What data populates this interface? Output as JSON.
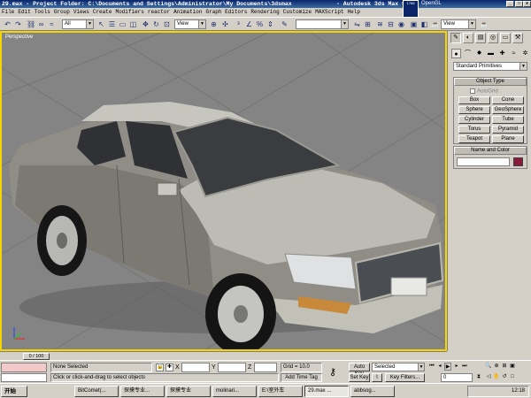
{
  "window": {
    "title": "29.max  - Project Folder: C:\\Documents and Settings\\Administrator\\My Documents\\3dsmax",
    "app_name": "- Autodesk 3ds Max 9",
    "renderer_badge": "OpenGL",
    "renderer_box": "1768"
  },
  "menu": [
    "File",
    "Edit",
    "Tools",
    "Group",
    "Views",
    "Create",
    "Modifiers",
    "reactor",
    "Animation",
    "Graph Editors",
    "Rendering",
    "Customize",
    "MAXScript",
    "Help"
  ],
  "toolbar": {
    "selection_filter": "All",
    "coord_system": "View",
    "view_right": "View"
  },
  "viewport": {
    "label": "Perspective",
    "border_color": "#f6d600",
    "background": "#848484"
  },
  "command_panel": {
    "tabs": [
      "create-tab",
      "modify-tab",
      "hierarchy-tab",
      "motion-tab",
      "display-tab",
      "utilities-tab"
    ],
    "subcategory": "Standard Primitives",
    "object_type": {
      "header": "Object Type",
      "autogrid": "AutoGrid",
      "buttons": [
        "Box",
        "Cone",
        "Sphere",
        "GeoSphere",
        "Cylinder",
        "Tube",
        "Torus",
        "Pyramid",
        "Teapot",
        "Plane"
      ]
    },
    "name_color": {
      "header": "Name and Color",
      "color": "#8a1a3c"
    }
  },
  "timeline": {
    "slider_label": "0 / 100"
  },
  "status": {
    "selection": "None Selected",
    "prompt": "Click or click-and-drag to select objects",
    "x_label": "X",
    "y_label": "Y",
    "z_label": "Z",
    "grid": "Grid = 10.0",
    "add_time_tag": "Add Time Tag"
  },
  "animation": {
    "auto_key": "Auto Key",
    "set_key": "Set Key",
    "key_mode": "Selected",
    "key_filters": "Key Filters...",
    "frame": "0"
  },
  "taskbar": {
    "start": "开始",
    "tasks": [
      "BitComet(...",
      "探摸专业...",
      "探摸专业",
      "molinari...",
      "E:\\室外车",
      "29.max ...",
      "abbsog..."
    ],
    "clock": "12:18"
  }
}
